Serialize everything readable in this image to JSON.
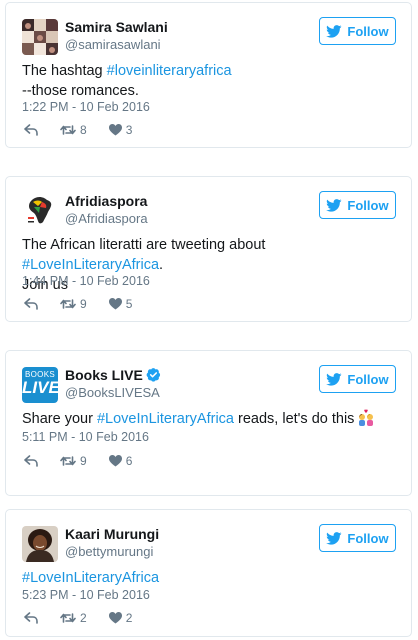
{
  "follow_label": "Follow",
  "colors": {
    "accent": "#1da1f2",
    "link": "#1b95e0",
    "muted": "#657786",
    "verified": "#1da1f2"
  },
  "tweets": [
    {
      "name": "Samira Sawlani",
      "handle": "@samirasawlani",
      "body": [
        "The hashtag ",
        "#loveinliteraryafrica",
        "--those romances."
      ],
      "timestamp": "1:22 PM - 10 Feb 2016",
      "retweets": "8",
      "likes": "3"
    },
    {
      "name": "Afridiaspora",
      "handle": "@Afridiaspora",
      "body": [
        "The African literatti are tweeting about ",
        "#LoveInLiteraryAfrica",
        ".",
        "Join us"
      ],
      "timestamp": "1:44 PM - 10 Feb 2016",
      "retweets": "9",
      "likes": "5"
    },
    {
      "name": "Books LIVE",
      "handle": "@BooksLIVESA",
      "verified": true,
      "avatar_text": [
        "BOOKS",
        "LIVE"
      ],
      "body": [
        "Share your ",
        "#LoveInLiteraryAfrica",
        " reads, let's do this"
      ],
      "emoji": "couple-with-heart-emoji",
      "timestamp": "5:11 PM - 10 Feb 2016",
      "retweets": "9",
      "likes": "6"
    },
    {
      "name": "Kaari Murungi",
      "handle": "@bettymurungi",
      "body": [
        "#LoveInLiteraryAfrica"
      ],
      "timestamp": "5:23 PM - 10 Feb 2016",
      "retweets": "2",
      "likes": "2"
    }
  ]
}
